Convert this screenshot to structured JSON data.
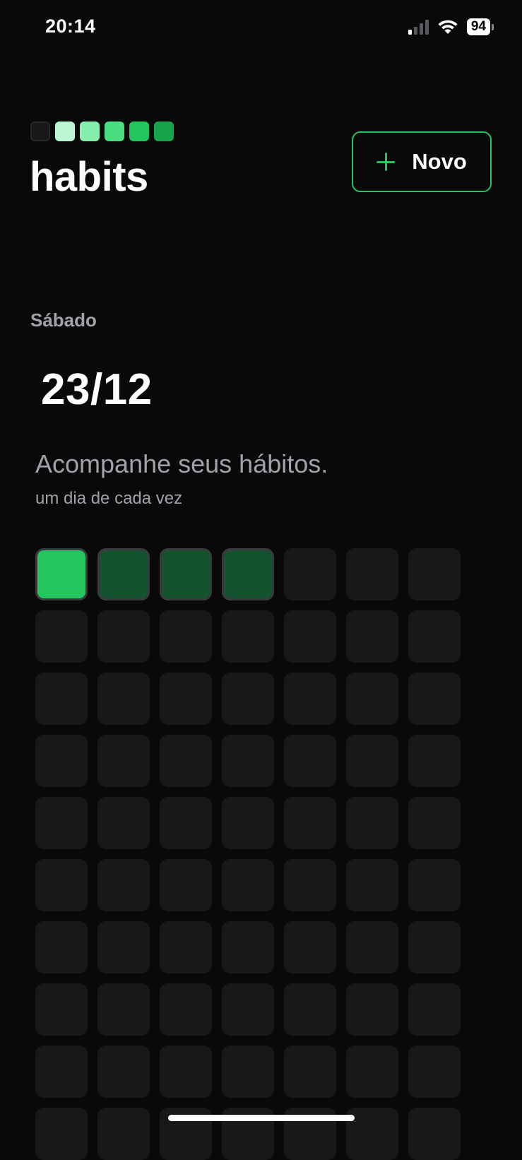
{
  "status_bar": {
    "time": "20:14",
    "battery": "94",
    "signal_bars_on": 1,
    "signal_bars_total": 4,
    "icons": [
      "signal-icon",
      "wifi-icon",
      "battery-icon"
    ]
  },
  "header": {
    "title": "habits",
    "logo_colors": [
      "#18181b",
      "#bbf7d0",
      "#86efac",
      "#4ade80",
      "#22c55e",
      "#16a34a"
    ],
    "new_button": {
      "label": "Novo",
      "icon": "plus-icon"
    }
  },
  "summary": {
    "weekday": "Sábado",
    "date": "23/12",
    "tagline": "Acompanhe seus hábitos.",
    "subtagline": "um dia de cada vez"
  },
  "heatmap": {
    "columns": 7,
    "total_cells": 70,
    "levels": [
      2,
      1,
      1,
      1
    ],
    "colors": {
      "empty": "#18181b",
      "level_1": "#14532d",
      "level_2": "#22c55e",
      "accent": "#22c55e"
    }
  }
}
